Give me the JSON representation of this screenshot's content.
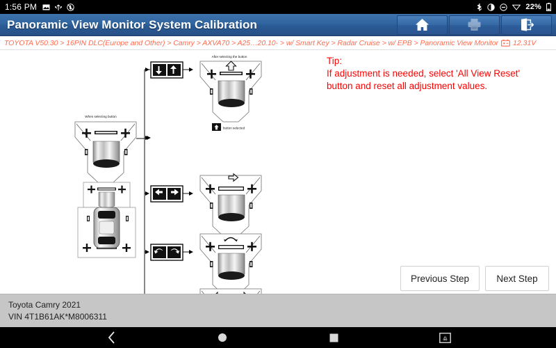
{
  "statusbar": {
    "clock": "1:56 PM",
    "left_icons": [
      "image-icon",
      "usb-icon",
      "no-sound-icon"
    ],
    "right_icons": [
      "bluetooth-icon",
      "brightness-icon",
      "do-not-disturb-icon",
      "wifi-icon"
    ],
    "battery_percent": "22%",
    "battery_icon": "battery-icon"
  },
  "titlebar": {
    "title": "Panoramic View Monitor System Calibration",
    "buttons": [
      {
        "name": "home-button",
        "icon": "home-icon",
        "enabled": true
      },
      {
        "name": "print-button",
        "icon": "printer-icon",
        "enabled": false
      },
      {
        "name": "exit-button",
        "icon": "exit-icon",
        "enabled": true
      }
    ]
  },
  "breadcrumb": {
    "path": "TOYOTA V50.30 > 16PIN DLC(Europe and Other) > Camry > AXVA70 > A25…20.10- > w/ Smart Key > Radar Cruise > w/ EPB > Panoramic View Monitor",
    "battery_icon": "battery-voltage-icon",
    "voltage": "12.31V",
    "color": "#ff6a4d"
  },
  "tip": {
    "heading": "Tip:",
    "line1": "If adjustment is needed, select 'All View Reset'",
    "line2": "button and reset all adjustment values.",
    "color": "#ff0000"
  },
  "diagram": {
    "source_caption": "When selecting button",
    "result_caption": "After selecting the button",
    "selected_caption": "button selected",
    "rows": [
      {
        "button_icon": "down-up-arrows-icon",
        "result_icon": "up-arrow-icon"
      },
      {
        "button_icon": "left-right-arrows-icon",
        "result_icon": "right-arrow-icon"
      },
      {
        "button_icon": "rotate-left-right-arrows-icon",
        "result_icon": "rotate-arrow-icon"
      },
      {
        "button_icon": "zoom-in-out-icon",
        "result_icon": "expand-arrows-icon"
      }
    ]
  },
  "steps": {
    "previous_label": "Previous Step",
    "next_label": "Next Step"
  },
  "footer": {
    "vehicle": "Toyota Camry 2021",
    "vin": "VIN 4T1B61AK*M8006311"
  },
  "navbar": {
    "items": [
      {
        "name": "nav-back-button",
        "icon": "back-chevron-icon"
      },
      {
        "name": "nav-home-button",
        "icon": "circle-icon"
      },
      {
        "name": "nav-recents-button",
        "icon": "square-icon"
      },
      {
        "name": "nav-screenshot-button",
        "icon": "screenshot-icon"
      }
    ]
  }
}
